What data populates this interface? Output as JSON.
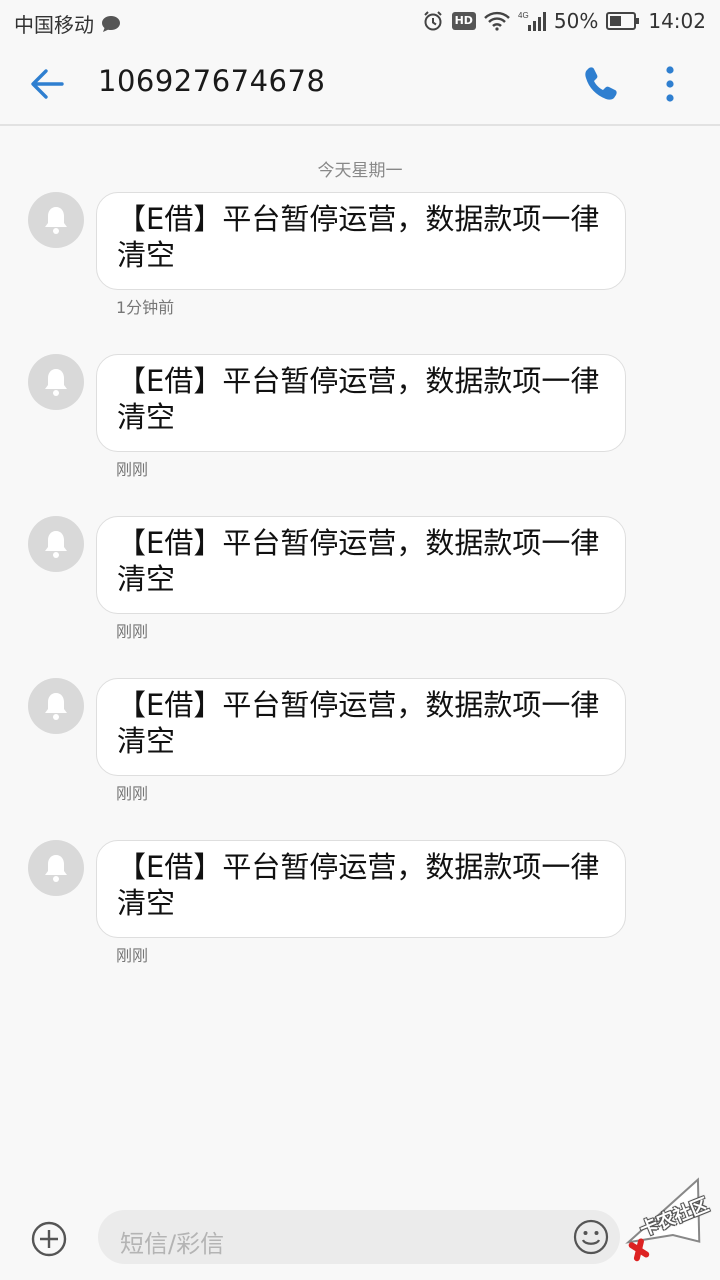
{
  "status_bar": {
    "carrier": "中国移动",
    "battery": "50%",
    "time": "14:02",
    "hd": "HD",
    "network": "4G"
  },
  "app_bar": {
    "title": "106927674678",
    "back_icon": "arrow-left-icon",
    "call_icon": "phone-icon",
    "more_icon": "more-vertical-icon",
    "accent_color": "#2f7fd0"
  },
  "conversation": {
    "date_divider": "今天星期一",
    "messages": [
      {
        "text": "【E借】平台暂停运营，数据款项一律清空",
        "time": "1分钟前"
      },
      {
        "text": "【E借】平台暂停运营，数据款项一律清空",
        "time": "刚刚"
      },
      {
        "text": "【E借】平台暂停运营，数据款项一律清空",
        "time": "刚刚"
      },
      {
        "text": "【E借】平台暂停运营，数据款项一律清空",
        "time": "刚刚"
      },
      {
        "text": "【E借】平台暂停运营，数据款项一律清空",
        "time": "刚刚"
      }
    ]
  },
  "composer": {
    "placeholder": "短信/彩信",
    "add_icon": "plus-circle-icon",
    "emoji_icon": "smiley-icon"
  },
  "watermark": {
    "text": "卡农社区"
  }
}
